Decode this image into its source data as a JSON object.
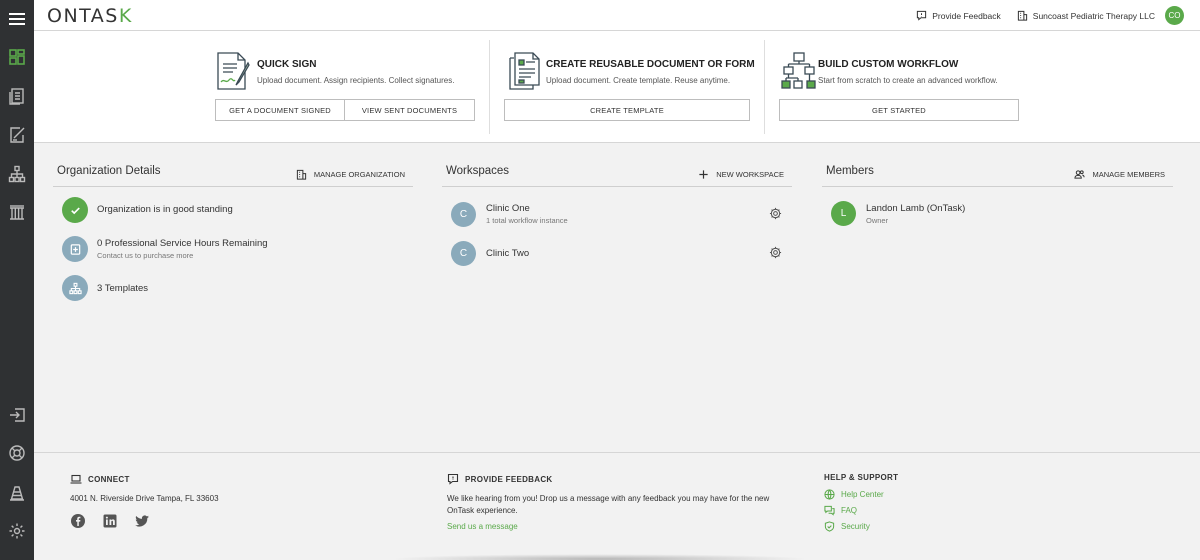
{
  "brand": {
    "logo_main": "ONTAS",
    "logo_k": "K"
  },
  "topbar": {
    "feedback_label": "Provide Feedback",
    "org_name": "Suncoast Pediatric Therapy LLC",
    "avatar_initials": "CO"
  },
  "colors": {
    "accent": "#5aa94a",
    "rail": "#2f3133",
    "workspace_avatar": "#8aaabb",
    "status_ok": "#5aa94a"
  },
  "quick_actions": [
    {
      "title": "QUICK SIGN",
      "subtitle": "Upload document. Assign recipients. Collect signatures.",
      "icon": "document-sign-icon",
      "buttons": [
        "GET A DOCUMENT SIGNED",
        "VIEW SENT DOCUMENTS"
      ]
    },
    {
      "title": "CREATE REUSABLE DOCUMENT OR FORM",
      "subtitle": "Upload document. Create template. Reuse anytime.",
      "icon": "template-document-icon",
      "buttons": [
        "CREATE TEMPLATE"
      ]
    },
    {
      "title": "BUILD CUSTOM WORKFLOW",
      "subtitle": "Start from scratch to create an advanced workflow.",
      "icon": "workflow-icon",
      "buttons": [
        "GET STARTED"
      ]
    }
  ],
  "organization": {
    "heading": "Organization Details",
    "action": "MANAGE ORGANIZATION",
    "items": [
      {
        "title": "Organization is in good standing",
        "sub": "",
        "icon": "check-icon"
      },
      {
        "title": "0 Professional Service Hours Remaining",
        "sub": "Contact us to purchase more",
        "icon": "medical-plus-icon"
      },
      {
        "title": "3 Templates",
        "sub": "",
        "icon": "hierarchy-icon"
      }
    ]
  },
  "workspaces": {
    "heading": "Workspaces",
    "action": "NEW WORKSPACE",
    "items": [
      {
        "initial": "C",
        "name": "Clinic One",
        "sub": "1 total workflow instance"
      },
      {
        "initial": "C",
        "name": "Clinic Two",
        "sub": ""
      }
    ]
  },
  "members": {
    "heading": "Members",
    "action": "MANAGE MEMBERS",
    "items": [
      {
        "initial": "L",
        "name": "Landon Lamb (OnTask)",
        "role": "Owner"
      }
    ]
  },
  "footer": {
    "connect": {
      "heading": "CONNECT",
      "address": "4001 N. Riverside Drive Tampa, FL 33603",
      "social": [
        "facebook-icon",
        "linkedin-icon",
        "twitter-icon"
      ]
    },
    "feedback": {
      "heading": "PROVIDE FEEDBACK",
      "text": "We like hearing from you! Drop us a message with any feedback you may have for the new OnTask experience.",
      "link": "Send us a message"
    },
    "help": {
      "heading": "HELP & SUPPORT",
      "links": [
        "Help Center",
        "FAQ",
        "Security"
      ]
    }
  }
}
